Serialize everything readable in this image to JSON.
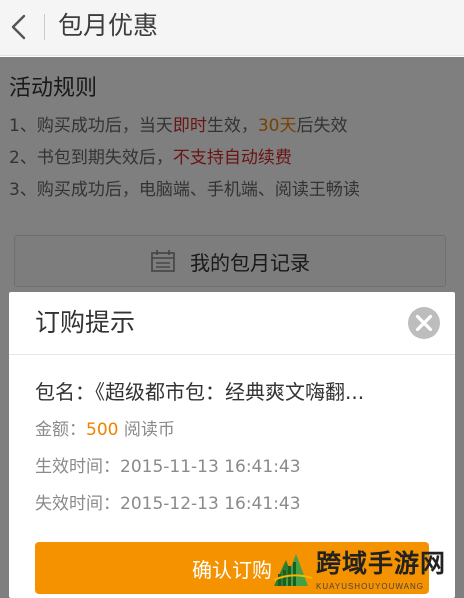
{
  "header": {
    "title": "包月优惠"
  },
  "rules": {
    "title": "活动规则",
    "rule1": {
      "prefix": "1、购买成功后，当天",
      "hl1": "即时",
      "mid": "生效，",
      "hl2": "30天",
      "suffix": "后失效"
    },
    "rule2": {
      "prefix": "2、书包到期失效后，",
      "hl": "不支持自动续费"
    },
    "rule3": {
      "text": "3、购买成功后，电脑端、手机端、阅读王畅读"
    }
  },
  "record_button": {
    "label": "我的包月记录"
  },
  "dialog": {
    "title": "订购提示",
    "package": "包名：《超级都市包：经典爽文嗨翻...",
    "amount_label": "金额：",
    "amount_value": "500",
    "amount_unit": " 阅读币",
    "start_time": "生效时间：2015-11-13 16:41:43",
    "end_time": "失效时间：2015-12-13 16:41:43",
    "confirm_label": "确认订购"
  },
  "watermark": {
    "text": "跨域手游网",
    "sub": "KUAYUSHOUYOUWANG"
  },
  "colors": {
    "accent": "#f49200",
    "highlight": "#f08200",
    "warning": "#d42b2b"
  },
  "icons": {
    "back": "chevron-left-icon",
    "calendar": "calendar-icon",
    "close": "close-circle-icon"
  }
}
